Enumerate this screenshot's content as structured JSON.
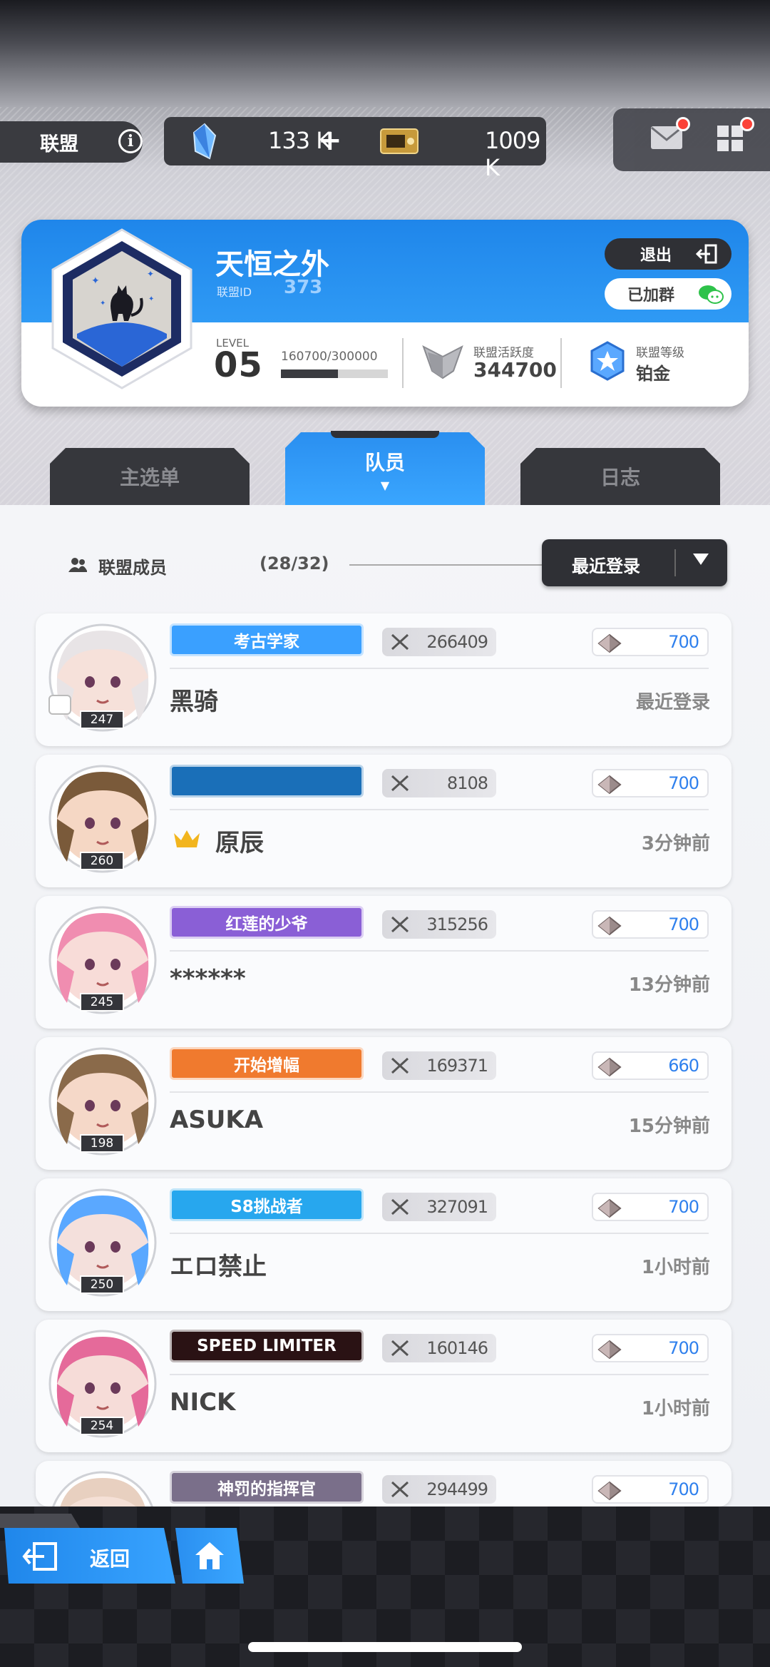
{
  "top_bar": {
    "alliance_label": "联盟",
    "info_icon": "i",
    "crystals": "133 K",
    "plus": "+",
    "tickets": "1009 K"
  },
  "alliance": {
    "name": "天恒之外",
    "id_label": "联盟ID",
    "id": "373",
    "quit_label": "退出",
    "group_label": "已加群",
    "level_label": "LEVEL",
    "level": "05",
    "exp": "160700/300000",
    "exp_progress": 0.5357,
    "activity_label": "联盟活跃度",
    "activity": "344700",
    "rank_label": "联盟等级",
    "rank": "铂金"
  },
  "tabs": [
    {
      "label": "主选单",
      "active": false
    },
    {
      "label": "队员",
      "active": true,
      "marker": "▼"
    },
    {
      "label": "日志",
      "active": false
    }
  ],
  "members_header": {
    "label": "联盟成员",
    "count": "(28/32)",
    "sort_label": "最近登录"
  },
  "members": [
    {
      "badge": "考古学家",
      "badge_color": "#3aa0ff",
      "power": "266409",
      "contribution": "700",
      "name": "黑骑",
      "time": "最近登录",
      "level": "247",
      "crown": false
    },
    {
      "badge": "",
      "badge_color": "#1a6fb8",
      "power": "8108",
      "contribution": "700",
      "name": "原辰",
      "time": "3分钟前",
      "level": "260",
      "crown": true
    },
    {
      "badge": "红莲的少爷",
      "badge_color": "#8a5fd6",
      "power": "315256",
      "contribution": "700",
      "name": "******",
      "time": "13分钟前",
      "level": "245",
      "crown": false
    },
    {
      "badge": "开始增幅",
      "badge_color": "#f07a2e",
      "power": "169371",
      "contribution": "660",
      "name": "ASUKA",
      "time": "15分钟前",
      "level": "198",
      "crown": false
    },
    {
      "badge": "S8挑战者",
      "badge_color": "#27a7ee",
      "power": "327091",
      "contribution": "700",
      "name": "エロ禁止",
      "time": "1小时前",
      "level": "250",
      "crown": false
    },
    {
      "badge": "SPEED LIMITER",
      "badge_color": "#2a1214",
      "power": "160146",
      "contribution": "700",
      "name": "NICK",
      "time": "1小时前",
      "level": "254",
      "crown": false
    },
    {
      "badge": "神罚的指挥官",
      "badge_color": "#7a6f8a",
      "power": "294499",
      "contribution": "700",
      "name": "",
      "time": "",
      "level": "",
      "crown": false
    }
  ],
  "bottom": {
    "back_label": "返回"
  },
  "colors": {
    "accent": "#2a8ff0",
    "dark": "#2f3035",
    "contribution": "#2f80ed"
  }
}
